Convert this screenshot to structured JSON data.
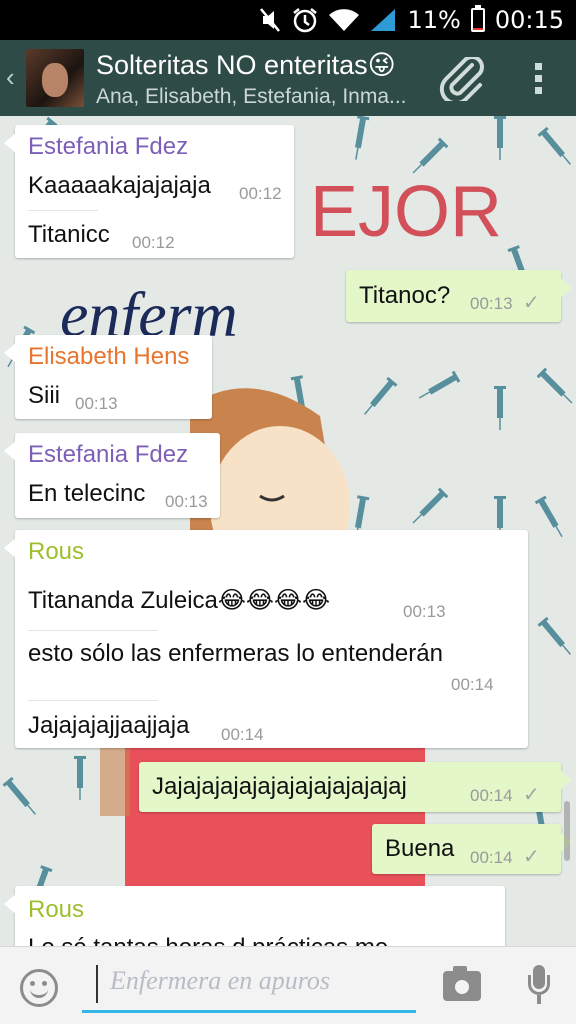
{
  "status_bar": {
    "battery_percent": "11%",
    "battery_level": 0.11,
    "time": "00:15",
    "icons": [
      "mute-icon",
      "alarm-icon",
      "wifi-icon",
      "signal-icon",
      "battery-icon"
    ]
  },
  "header": {
    "back_glyph": "‹",
    "title": "Solteritas NO enteritas😜",
    "subtitle": "Ana, Elisabeth, Estefania, Inma...",
    "icons": [
      "back-icon",
      "group-avatar",
      "attach-icon",
      "overflow-menu-icon"
    ]
  },
  "messages": [
    {
      "sender": "Estefania Fdez",
      "sender_color": "#7e5fb8",
      "lines": [
        {
          "text": "Kaaaaakajajajaja",
          "time": "00:12"
        },
        {
          "text": "Titanicc",
          "time": "00:12"
        }
      ]
    },
    {
      "outgoing": true,
      "lines": [
        {
          "text": "Titanoc?",
          "time": "00:13",
          "tick": "✓"
        }
      ]
    },
    {
      "sender": "Elisabeth Hens",
      "sender_color": "#e8742e",
      "lines": [
        {
          "text": "Siii",
          "time": "00:13"
        }
      ]
    },
    {
      "sender": "Estefania Fdez",
      "sender_color": "#7e5fb8",
      "lines": [
        {
          "text": "En telecinc",
          "time": "00:13"
        }
      ]
    },
    {
      "sender": "Rous",
      "sender_color": "#9cbf2e",
      "lines": [
        {
          "text": "Titananda Zuleica😂😂😂😂",
          "time": "00:13"
        },
        {
          "text": "esto sólo las enfermeras lo entenderán",
          "time": "00:14"
        },
        {
          "text": "Jajajajajjaajjaja",
          "time": "00:14"
        }
      ]
    },
    {
      "outgoing": true,
      "lines": [
        {
          "text": "Jajajajajajajajajajajajajaj",
          "time": "00:14",
          "tick": "✓"
        }
      ]
    },
    {
      "outgoing": true,
      "lines": [
        {
          "text": "Buena",
          "time": "00:14",
          "tick": "✓"
        }
      ]
    },
    {
      "sender": "Rous",
      "sender_color": "#9cbf2e",
      "lines": [
        {
          "text": "Lo sé tantas horas d prácticas me",
          "time": ""
        }
      ]
    }
  ],
  "wallpaper": {
    "word_top": "EJOR",
    "word_middle": "enferm",
    "word_bottom": "Enfermera en apuros"
  },
  "input_bar": {
    "placeholder": "",
    "icons": [
      "emoji-icon",
      "camera-icon",
      "microphone-icon"
    ]
  },
  "colors": {
    "header": "#2f4b48",
    "outgoing_bubble": "#e4f7c9",
    "incoming_bubble": "#ffffff",
    "input_underline": "#33b5e5"
  }
}
